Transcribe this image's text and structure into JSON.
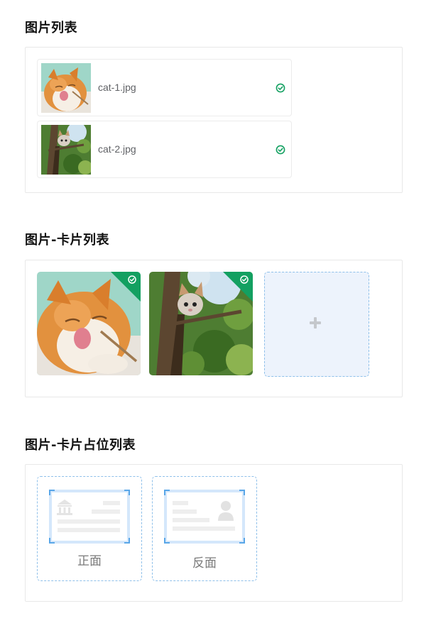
{
  "sections": {
    "list": {
      "title": "图片列表",
      "items": [
        {
          "name": "cat-1.jpg",
          "status": "success"
        },
        {
          "name": "cat-2.jpg",
          "status": "success"
        }
      ]
    },
    "cards": {
      "title": "图片-卡片列表",
      "items": [
        {
          "image": "cat-1",
          "status": "success"
        },
        {
          "image": "cat-2",
          "status": "success"
        }
      ],
      "add_icon": "plus-icon"
    },
    "placeholders": {
      "title": "图片-卡片占位列表",
      "items": [
        {
          "label": "正面",
          "icon": "id-card-front-icon"
        },
        {
          "label": "反面",
          "icon": "id-card-back-icon"
        }
      ]
    }
  },
  "colors": {
    "success": "#13a061",
    "border": "#e8e8e8",
    "dashed_border": "#8fc0ea",
    "add_card_bg": "#edf3fc",
    "placeholder_frame": "#d4e7fb",
    "placeholder_gray": "#eeeeee"
  }
}
